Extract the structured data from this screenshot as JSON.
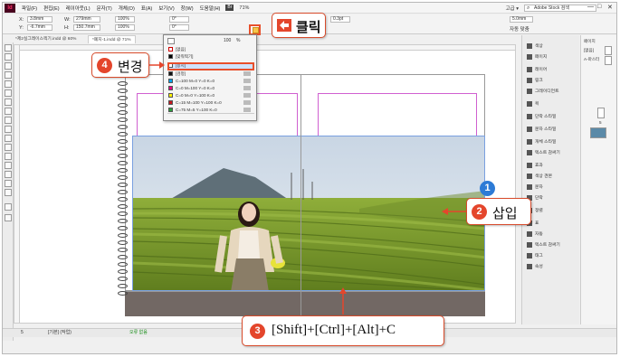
{
  "app": {
    "logo": "Id",
    "menu": [
      "파일(F)",
      "편집(E)",
      "레이아웃(L)",
      "문자(T)",
      "개체(O)",
      "표(A)",
      "보기(V)",
      "창(W)",
      "도움말(H)"
    ],
    "menu_pill": "Br",
    "zoom": "71%",
    "workspace": "고급 ▾",
    "stock_search_placeholder": "Adobe Stock 검색",
    "win_minimize": "—",
    "win_maximize": "□",
    "win_close": "✕"
  },
  "controlbar": {
    "x_label": "X:",
    "x_value": "3.8mm",
    "y_label": "Y:",
    "y_value": "-6.7mm",
    "w_label": "W:",
    "w_value": "279mm",
    "h_label": "H:",
    "h_value": "150.7mm",
    "scale_x": "100%",
    "scale_y": "100%",
    "rotate": "0°",
    "shear": "0°",
    "stroke_weight": "0.3pt",
    "stroke_value": "5.0mm",
    "auto_fit_label": "자동 맞춤"
  },
  "tabs": [
    {
      "label": "*제2실그레이스찍기.indd @ 60%",
      "active": false
    },
    {
      "label": "*폐지-1.indd @ 71%",
      "active": true
    }
  ],
  "swatch_panel": {
    "header_value": "100",
    "header_pct": "%",
    "items": [
      {
        "name": "[없음]",
        "color": "#ffffff"
      },
      {
        "name": "[맞춰찍기]",
        "color": "#000000"
      },
      {
        "name": "[용지]",
        "color": "#ffffff"
      },
      {
        "name": "[검정]",
        "color": "#111111"
      },
      {
        "name": "C=100 M=0 Y=0 K=0",
        "color": "#00a0e9"
      },
      {
        "name": "C=0 M=100 Y=0 K=0",
        "color": "#e4007f"
      },
      {
        "name": "C=0 M=0 Y=100 K=0",
        "color": "#fff100"
      },
      {
        "name": "C=15 M=100 Y=100 K=0",
        "color": "#c7161e"
      },
      {
        "name": "C=75 M=5 Y=100 K=0",
        "color": "#2aa03c"
      }
    ],
    "selected_index": 2
  },
  "right_panel": {
    "items": [
      "색상",
      "페이지",
      "레이어",
      "링크",
      "그레이디언트",
      "획",
      "단락 스타일",
      "문자 스타일",
      "개체 스타일",
      "텍스트 감싸기",
      "효과",
      "색상 견본",
      "문자",
      "단락",
      "정렬",
      "표",
      "자동",
      "텍스트 감싸기",
      "태그",
      "속성"
    ]
  },
  "pages_panel": {
    "tab_label": "페이지",
    "master_none": "[없음]",
    "master_a": "A-마스터",
    "page_num": "5"
  },
  "status": {
    "page": "5",
    "preset": "[기본] (작업)",
    "errors": "오류 없음"
  },
  "callouts": {
    "click_label": "클릭",
    "change_num": "4",
    "change_label": "변경",
    "insert_num": "2",
    "insert_label": "삽입",
    "shortcut_num": "3",
    "shortcut_label": "[Shift]+[Ctrl]+[Alt]+C",
    "step1_num": "1"
  },
  "colors": {
    "accent": "#e4462c",
    "blue_badge": "#2d7bd6",
    "bleed": "#726864",
    "highlight_yellow": "#f8c54b"
  }
}
